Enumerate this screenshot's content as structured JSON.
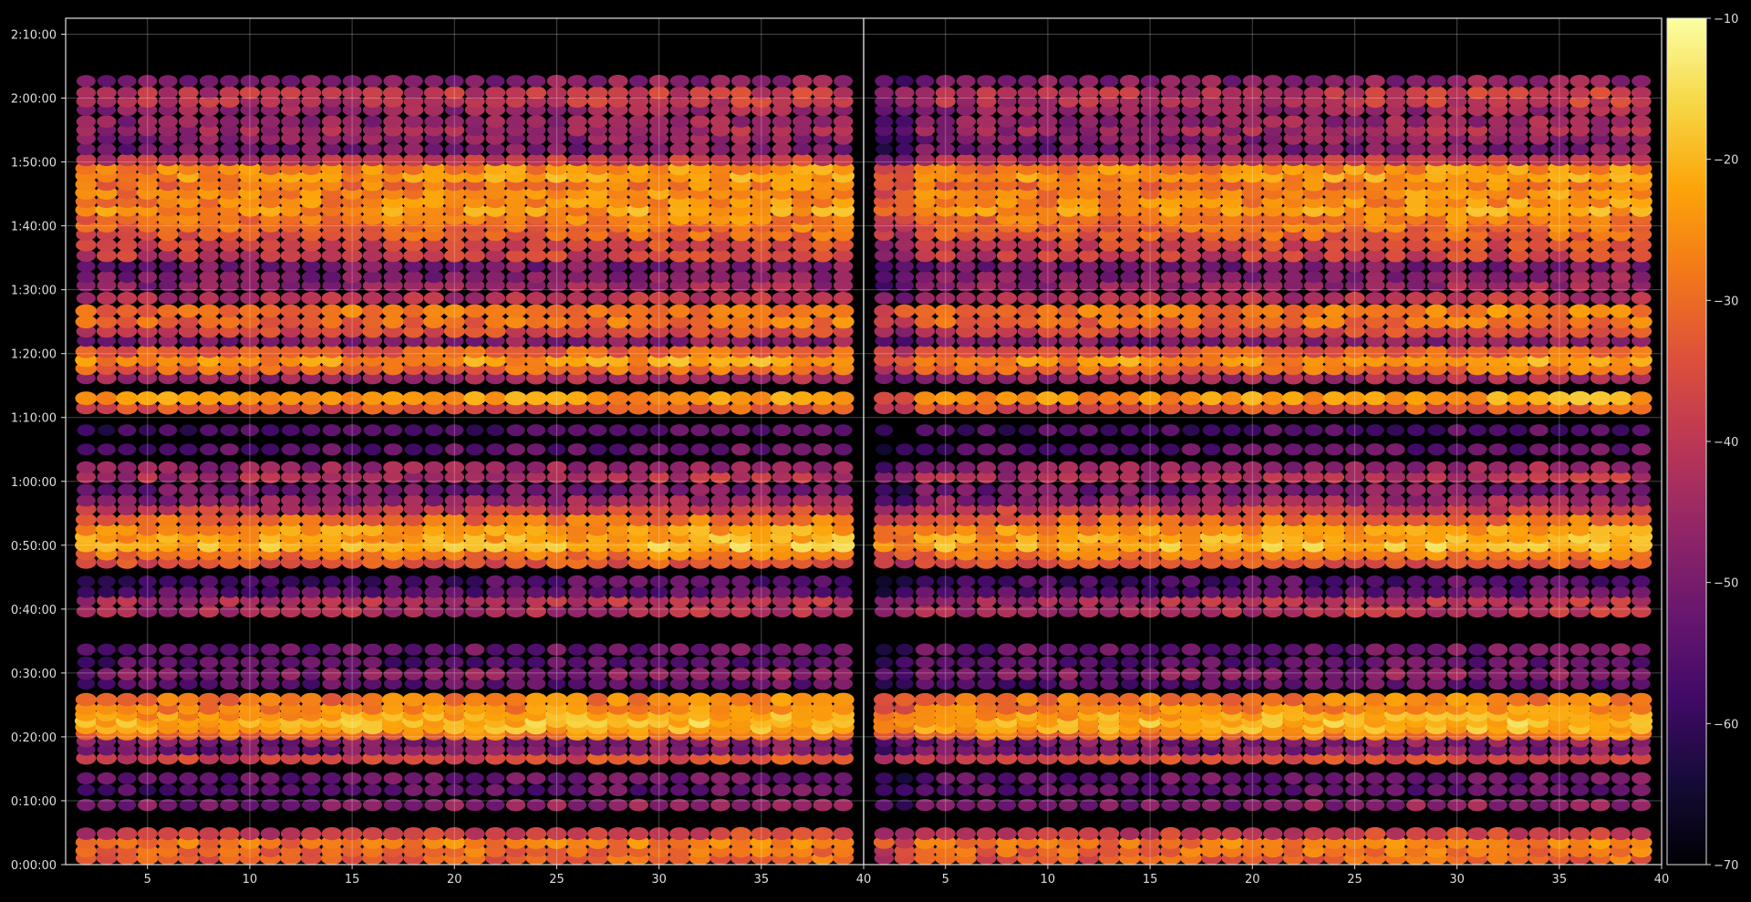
{
  "chart_data": {
    "type": "heatmap",
    "title": "",
    "xlabel": "",
    "ylabel": "",
    "panels": [
      {
        "name": "",
        "x_range": [
          1,
          40
        ],
        "x_ticks": [
          5,
          10,
          15,
          20,
          25,
          30,
          35,
          40
        ]
      },
      {
        "name": "",
        "x_range": [
          1,
          40
        ],
        "x_ticks": [
          5,
          10,
          15,
          20,
          25,
          30,
          35,
          40
        ]
      }
    ],
    "x_tick_labels": [
      "5",
      "10",
      "15",
      "20",
      "25",
      "30",
      "35",
      "40"
    ],
    "y_range_seconds": [
      0,
      7950
    ],
    "y_ticks_seconds": [
      0,
      600,
      1200,
      1800,
      2400,
      3000,
      3600,
      4200,
      4800,
      5400,
      6000,
      6600,
      7200,
      7800
    ],
    "y_tick_labels": [
      "0:00:00",
      "0:10:00",
      "0:20:00",
      "0:30:00",
      "0:40:00",
      "0:50:00",
      "1:00:00",
      "1:10:00",
      "1:20:00",
      "1:30:00",
      "1:40:00",
      "1:50:00",
      "2:00:00",
      "2:10:00"
    ],
    "colorbar": {
      "colormap": "inferno",
      "range": [
        -70,
        -10
      ],
      "ticks": [
        -70,
        -60,
        -50,
        -40,
        -30,
        -20,
        -10
      ],
      "tick_labels": [
        "−70",
        "−60",
        "−50",
        "−40",
        "−30",
        "−20",
        "−10"
      ]
    },
    "grid": true,
    "background": "#000000",
    "band_profile_seconds_to_level": [
      [
        60,
        -34
      ],
      [
        130,
        -32
      ],
      [
        210,
        -30
      ],
      [
        290,
        -40
      ],
      [
        560,
        -50
      ],
      [
        700,
        -56
      ],
      [
        810,
        -54
      ],
      [
        1000,
        -38
      ],
      [
        1080,
        -52
      ],
      [
        1160,
        -50
      ],
      [
        1230,
        -30
      ],
      [
        1290,
        -24
      ],
      [
        1350,
        -22
      ],
      [
        1410,
        -24
      ],
      [
        1470,
        -28
      ],
      [
        1550,
        -30
      ],
      [
        1700,
        -56
      ],
      [
        1790,
        -50
      ],
      [
        1900,
        -56
      ],
      [
        2020,
        -54
      ],
      [
        2380,
        -44
      ],
      [
        2480,
        -44
      ],
      [
        2560,
        -56
      ],
      [
        2660,
        -58
      ],
      [
        2840,
        -36
      ],
      [
        2920,
        -30
      ],
      [
        3000,
        -22
      ],
      [
        3080,
        -24
      ],
      [
        3150,
        -26
      ],
      [
        3240,
        -32
      ],
      [
        3340,
        -40
      ],
      [
        3420,
        -48
      ],
      [
        3520,
        -52
      ],
      [
        3640,
        -44
      ],
      [
        3730,
        -48
      ],
      [
        3900,
        -56
      ],
      [
        4080,
        -58
      ],
      [
        4290,
        -36
      ],
      [
        4380,
        -26
      ],
      [
        4570,
        -46
      ],
      [
        4660,
        -32
      ],
      [
        4740,
        -26
      ],
      [
        4820,
        -34
      ],
      [
        4920,
        -50
      ],
      [
        5010,
        -38
      ],
      [
        5100,
        -32
      ],
      [
        5200,
        -30
      ],
      [
        5320,
        -44
      ],
      [
        5440,
        -48
      ],
      [
        5520,
        -50
      ],
      [
        5620,
        -52
      ],
      [
        5720,
        -40
      ],
      [
        5820,
        -38
      ],
      [
        5920,
        -34
      ],
      [
        6000,
        -32
      ],
      [
        6070,
        -30
      ],
      [
        6150,
        -26
      ],
      [
        6230,
        -28
      ],
      [
        6310,
        -28
      ],
      [
        6390,
        -30
      ],
      [
        6470,
        -26
      ],
      [
        6540,
        -28
      ],
      [
        6620,
        -42
      ],
      [
        6720,
        -52
      ],
      [
        6820,
        -50
      ],
      [
        6900,
        -46
      ],
      [
        6980,
        -48
      ],
      [
        7090,
        -48
      ],
      [
        7170,
        -42
      ],
      [
        7250,
        -42
      ],
      [
        7360,
        -50
      ]
    ]
  }
}
